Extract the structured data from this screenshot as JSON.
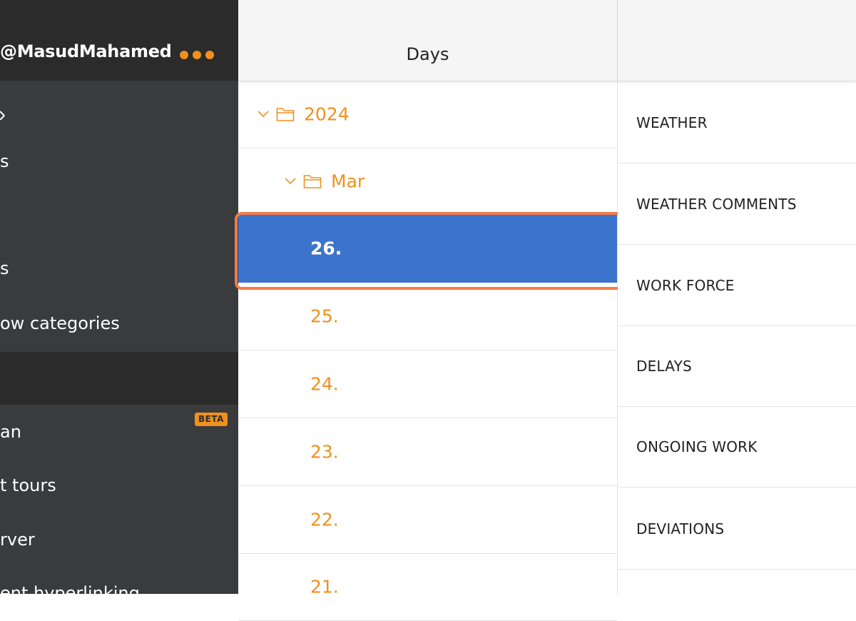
{
  "sidebar": {
    "username": "@MasudMahamed",
    "items": [
      {
        "label": "s"
      },
      {
        "label": "s"
      },
      {
        "label": "ow categories"
      },
      {
        "label": "an"
      },
      {
        "label": "t tours"
      },
      {
        "label": "rver"
      },
      {
        "label": "ent hyperlinking"
      }
    ],
    "beta_label": "BETA"
  },
  "days": {
    "title": "Days",
    "year": "2024",
    "month": "Mar",
    "entries": [
      "26.",
      "25.",
      "24.",
      "23.",
      "22.",
      "21."
    ],
    "selected": "26."
  },
  "categories": {
    "items": [
      "WEATHER",
      "WEATHER COMMENTS",
      "WORK FORCE",
      "DELAYS",
      "ONGOING WORK",
      "DEVIATIONS"
    ]
  },
  "colors": {
    "accent": "#f0901e",
    "selection": "#3c73cc",
    "highlight": "#f47c45",
    "sidebar_bg": "#3a3b3d",
    "sidebar_header_bg": "#2b2b2b"
  }
}
